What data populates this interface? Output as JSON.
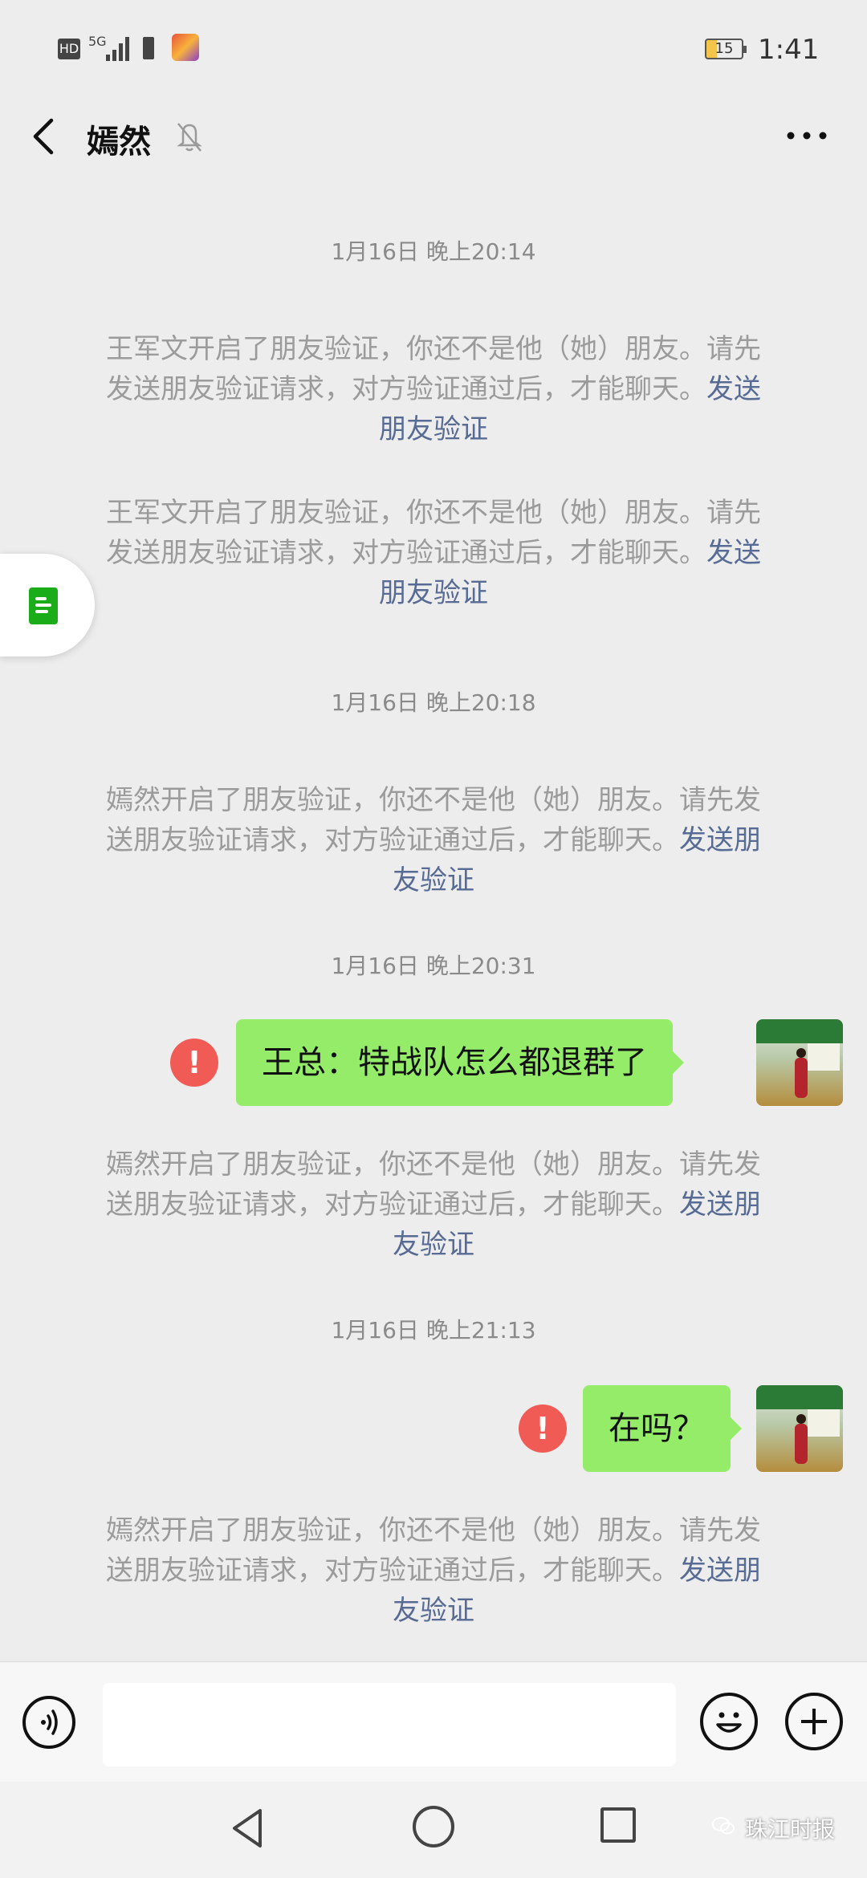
{
  "status_bar": {
    "hd": "HD",
    "network": "5G",
    "battery": "15",
    "time": "1:41"
  },
  "header": {
    "title": "嫣然",
    "back_icon": "chevron-left-icon",
    "mute_icon": "bell-off-icon",
    "more_icon": "more-dots-icon"
  },
  "messages": [
    {
      "kind": "time",
      "text": "1月16日 晚上20:14"
    },
    {
      "kind": "system",
      "lines": [
        "王军文开启了朋友验证，你还不是他（她）朋友。请先",
        "发送朋友验证请求，对方验证通过后，才能聊天。"
      ],
      "link_tail": "发送",
      "link_line": "朋友验证"
    },
    {
      "kind": "system",
      "lines": [
        "王军文开启了朋友验证，你还不是他（她）朋友。请先",
        "发送朋友验证请求，对方验证通过后，才能聊天。"
      ],
      "link_tail": "发送",
      "link_line": "朋友验证"
    },
    {
      "kind": "time",
      "text": "1月16日 晚上20:18"
    },
    {
      "kind": "system",
      "lines": [
        "嫣然开启了朋友验证，你还不是他（她）朋友。请先发",
        "送朋友验证请求，对方验证通过后，才能聊天。"
      ],
      "link_tail": "发送朋",
      "link_line": "友验证"
    },
    {
      "kind": "time",
      "text": "1月16日 晚上20:31"
    },
    {
      "kind": "sent",
      "text": "王总：特战队怎么都退群了",
      "failed": "!"
    },
    {
      "kind": "system",
      "lines": [
        "嫣然开启了朋友验证，你还不是他（她）朋友。请先发",
        "送朋友验证请求，对方验证通过后，才能聊天。"
      ],
      "link_tail": "发送朋",
      "link_line": "友验证"
    },
    {
      "kind": "time",
      "text": "1月16日 晚上21:13"
    },
    {
      "kind": "sent",
      "text": "在吗？",
      "failed": "!"
    },
    {
      "kind": "system",
      "lines": [
        "嫣然开启了朋友验证，你还不是他（她）朋友。请先发",
        "送朋友验证请求，对方验证通过后，才能聊天。"
      ],
      "link_tail": "发送朋",
      "link_line": "友验证"
    }
  ],
  "input_bar": {
    "voice_icon": "voice-icon",
    "text_value": "",
    "emoji_icon": "emoji-icon",
    "plus_icon": "plus-icon"
  },
  "watermark": "珠江时报",
  "colors": {
    "bubble": "#95ec69",
    "link": "#576b95",
    "error": "#f15b55",
    "background": "#ededed"
  }
}
